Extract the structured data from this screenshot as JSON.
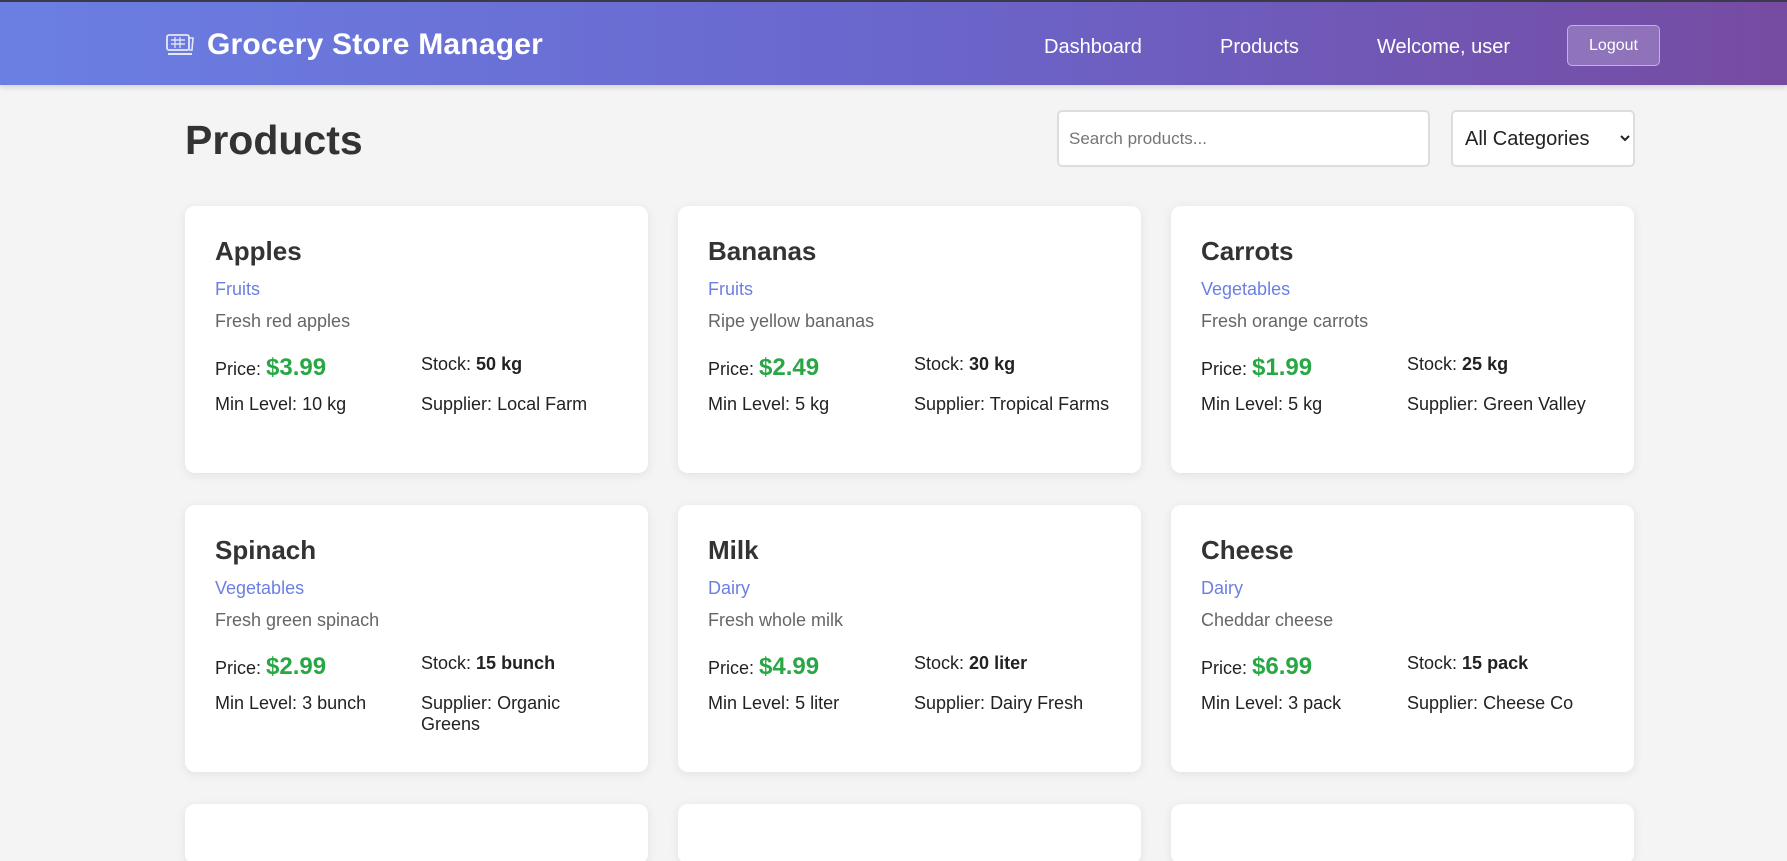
{
  "header": {
    "title": "Grocery Store Manager",
    "logo_icon": "cash-register-icon",
    "nav": {
      "dashboard": "Dashboard",
      "products": "Products",
      "welcome": "Welcome, user",
      "logout": "Logout"
    },
    "gradient_start": "#667eea",
    "gradient_end": "#764ba2"
  },
  "page": {
    "title": "Products",
    "search_placeholder": "Search products...",
    "category_filter": {
      "selected": "All Categories"
    }
  },
  "colors": {
    "category": "#6b7fe3",
    "price": "#28a745"
  },
  "labels": {
    "price": "Price:",
    "stock": "Stock:",
    "min_level": "Min Level:",
    "supplier": "Supplier:"
  },
  "products": [
    {
      "name": "Apples",
      "category": "Fruits",
      "description": "Fresh red apples",
      "price": "$3.99",
      "stock": "50 kg",
      "min_level": "10 kg",
      "supplier": "Local Farm"
    },
    {
      "name": "Bananas",
      "category": "Fruits",
      "description": "Ripe yellow bananas",
      "price": "$2.49",
      "stock": "30 kg",
      "min_level": "5 kg",
      "supplier": "Tropical Farms"
    },
    {
      "name": "Carrots",
      "category": "Vegetables",
      "description": "Fresh orange carrots",
      "price": "$1.99",
      "stock": "25 kg",
      "min_level": "5 kg",
      "supplier": "Green Valley"
    },
    {
      "name": "Spinach",
      "category": "Vegetables",
      "description": "Fresh green spinach",
      "price": "$2.99",
      "stock": "15 bunch",
      "min_level": "3 bunch",
      "supplier": "Organic Greens"
    },
    {
      "name": "Milk",
      "category": "Dairy",
      "description": "Fresh whole milk",
      "price": "$4.99",
      "stock": "20 liter",
      "min_level": "5 liter",
      "supplier": "Dairy Fresh"
    },
    {
      "name": "Cheese",
      "category": "Dairy",
      "description": "Cheddar cheese",
      "price": "$6.99",
      "stock": "15 pack",
      "min_level": "3 pack",
      "supplier": "Cheese Co"
    }
  ]
}
